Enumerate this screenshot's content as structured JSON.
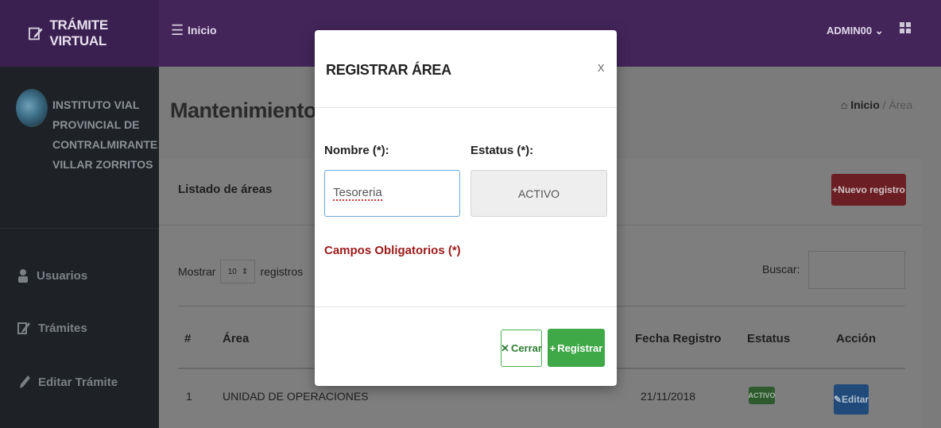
{
  "navbar": {
    "brand": "TRÁMITE VIRTUAL",
    "menu_label": "Inicio",
    "user": "ADMIN00",
    "user_caret": "⌄"
  },
  "sidebar": {
    "org_lines": [
      "INSTITUTO VIAL",
      "PROVINCIAL DE",
      "CONTRALMIRANTE",
      "VILLAR ZORRITOS"
    ],
    "items": [
      {
        "label": "Usuarios",
        "icon": "user-icon"
      },
      {
        "label": "Trámites",
        "icon": "edit-icon"
      },
      {
        "label": "Editar Trámite",
        "icon": "pen-icon"
      }
    ]
  },
  "main": {
    "title": "Mantenimiento de",
    "breadcrumb": {
      "home": "Inicio",
      "sep": "/",
      "current": "Área"
    },
    "card_title": "Listado de áreas",
    "new_button": "Nuevo registro",
    "show_prefix": "Mostrar",
    "show_value": "10",
    "show_suffix": "registros",
    "search_label": "Buscar:",
    "table": {
      "headers": [
        "#",
        "Área",
        "Fecha Registro",
        "Estatus",
        "Acción"
      ],
      "rows": [
        {
          "num": "1",
          "area": "UNIDAD DE OPERACIONES",
          "fecha": "21/11/2018",
          "estatus": "ACTIVO",
          "accion": "Editar"
        }
      ]
    }
  },
  "modal": {
    "title": "REGISTRAR ÁREA",
    "close": "x",
    "name_label": "Nombre (*):",
    "name_value": "Tesoreria",
    "status_label": "Estatus (*):",
    "status_value": "ACTIVO",
    "required_note": "Campos Obligatorios (*)",
    "cancel_button": "Cerrar",
    "submit_button": "Registrar"
  },
  "colors": {
    "navbar": "#43255a",
    "sidebar": "#1e2226",
    "danger": "#6b1e24",
    "success": "#3fa847",
    "required_text": "#9b1a1a"
  }
}
